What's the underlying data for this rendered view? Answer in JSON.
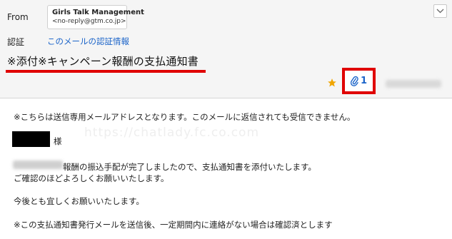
{
  "header": {
    "from_label": "From",
    "sender_name": "Girls Talk Management",
    "sender_email": "<no-reply@gtm.co.jp>",
    "auth_label": "認証",
    "auth_link": "このメールの認証情報",
    "subject": "※添付※キャンペーン報酬の支払通知書",
    "attachment_count": "1",
    "expand_icon": "chevron-down-icon",
    "star_icon": "star-icon",
    "attachment_icon": "paperclip-icon"
  },
  "body": {
    "notice": "※こちらは送信専用メールアドレスとなります。このメールに返信されても受信できません。",
    "watermark": "https://chatlady.fc.co.com",
    "honorific": "様",
    "line_transfer": "報酬の振込手配が完了しましたので、支払通知書を添付いたします。",
    "line_confirm": "ご確認のほどよろしくお願いいたします。",
    "line_regards": "今後とも宜しくお願いいたします。",
    "line_footer": "※この支払通知書発行メールを送信後、一定期間内に連絡がない場合は確認済とします"
  },
  "colors": {
    "accent": "#1b64c9",
    "highlight_red": "#e00000",
    "star": "#f0a500",
    "header_bg": "#f5f5f5"
  }
}
